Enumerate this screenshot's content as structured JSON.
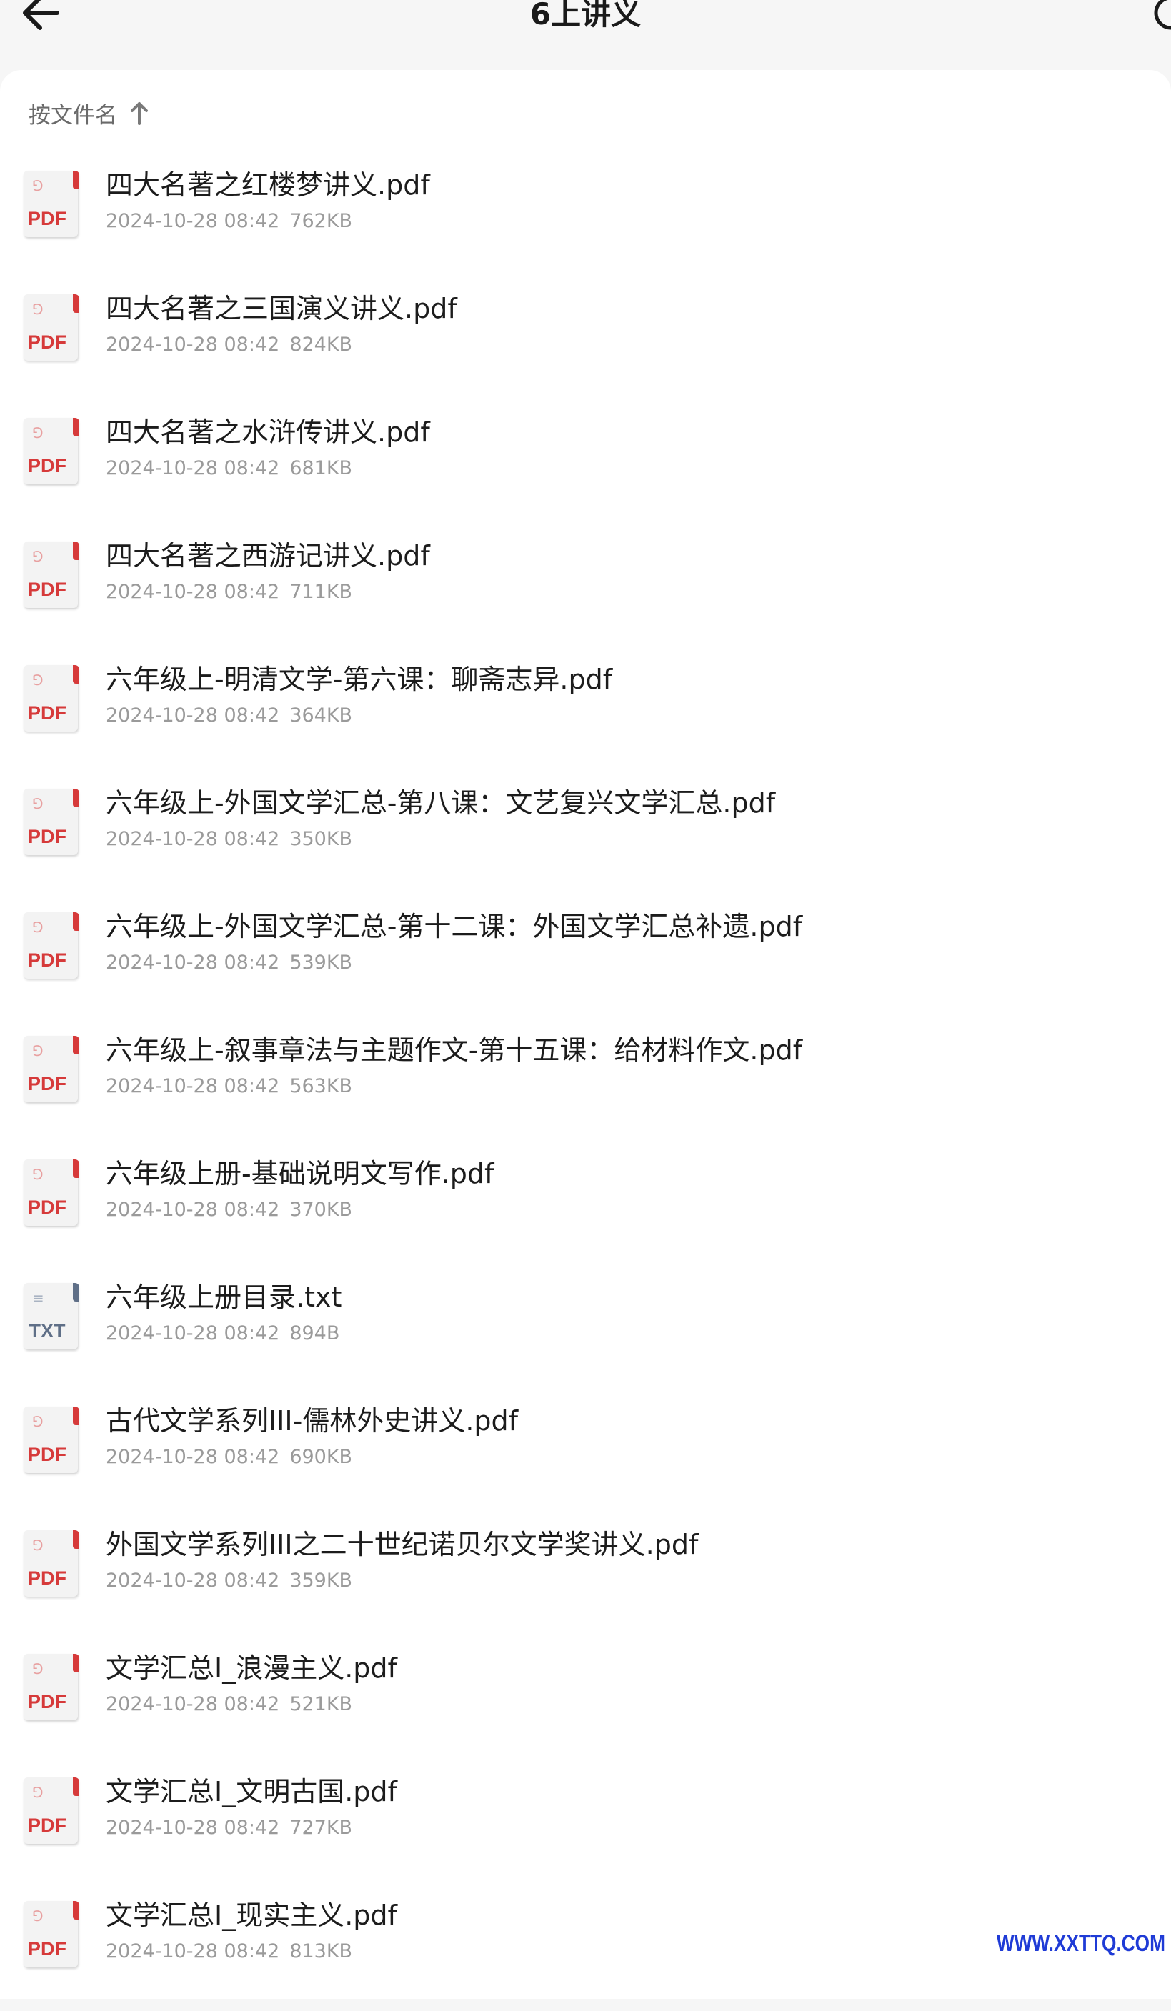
{
  "header": {
    "title": "6上讲义",
    "back_icon": "arrow-left-icon",
    "search_icon": "search-icon"
  },
  "sort": {
    "label": "按文件名",
    "direction_icon": "arrow-up-icon"
  },
  "colors": {
    "pdf": "#d63a3a",
    "txt": "#5f6f87"
  },
  "files": [
    {
      "name": "四大名著之红楼梦讲义.pdf",
      "date": "2024-10-28 08:42",
      "size": "762KB",
      "type": "PDF"
    },
    {
      "name": "四大名著之三国演义讲义.pdf",
      "date": "2024-10-28 08:42",
      "size": "824KB",
      "type": "PDF"
    },
    {
      "name": "四大名著之水浒传讲义.pdf",
      "date": "2024-10-28 08:42",
      "size": "681KB",
      "type": "PDF"
    },
    {
      "name": "四大名著之西游记讲义.pdf",
      "date": "2024-10-28 08:42",
      "size": "711KB",
      "type": "PDF"
    },
    {
      "name": "六年级上-明清文学-第六课：聊斋志异.pdf",
      "date": "2024-10-28 08:42",
      "size": "364KB",
      "type": "PDF"
    },
    {
      "name": "六年级上-外国文学汇总-第八课：文艺复兴文学汇总.pdf",
      "date": "2024-10-28 08:42",
      "size": "350KB",
      "type": "PDF"
    },
    {
      "name": "六年级上-外国文学汇总-第十二课：外国文学汇总补遗.pdf",
      "date": "2024-10-28 08:42",
      "size": "539KB",
      "type": "PDF"
    },
    {
      "name": "六年级上-叙事章法与主题作文-第十五课：给材料作文.pdf",
      "date": "2024-10-28 08:42",
      "size": "563KB",
      "type": "PDF"
    },
    {
      "name": "六年级上册-基础说明文写作.pdf",
      "date": "2024-10-28 08:42",
      "size": "370KB",
      "type": "PDF"
    },
    {
      "name": "六年级上册目录.txt",
      "date": "2024-10-28 08:42",
      "size": "894B",
      "type": "TXT"
    },
    {
      "name": "古代文学系列III-儒林外史讲义.pdf",
      "date": "2024-10-28 08:42",
      "size": "690KB",
      "type": "PDF"
    },
    {
      "name": "外国文学系列III之二十世纪诺贝尔文学奖讲义.pdf",
      "date": "2024-10-28 08:42",
      "size": "359KB",
      "type": "PDF"
    },
    {
      "name": "文学汇总I_浪漫主义.pdf",
      "date": "2024-10-28 08:42",
      "size": "521KB",
      "type": "PDF"
    },
    {
      "name": "文学汇总I_文明古国.pdf",
      "date": "2024-10-28 08:42",
      "size": "727KB",
      "type": "PDF"
    },
    {
      "name": "文学汇总I_现实主义.pdf",
      "date": "2024-10-28 08:42",
      "size": "813KB",
      "type": "PDF"
    }
  ],
  "watermark": "WWW.XXTTQ.COM"
}
